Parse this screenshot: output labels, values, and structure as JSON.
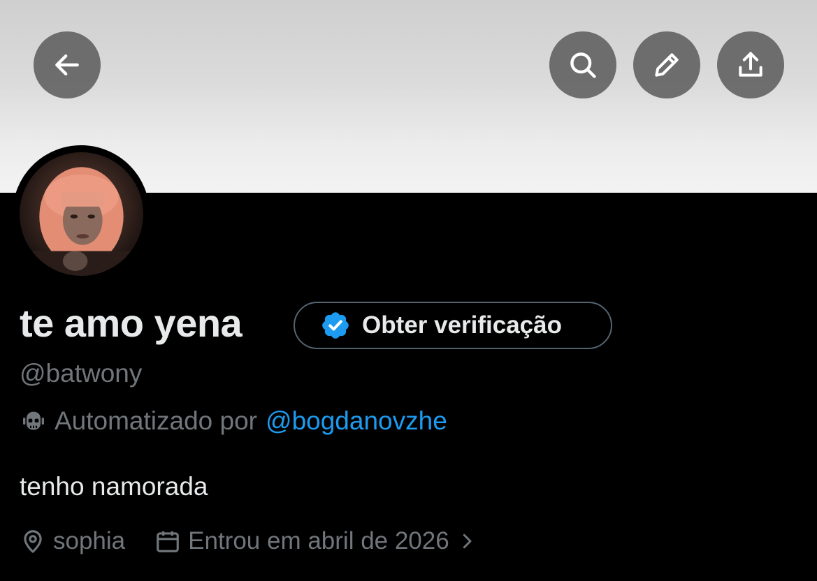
{
  "header": {
    "back_icon": "arrow-left-icon",
    "search_icon": "search-icon",
    "edit_icon": "pencil-icon",
    "share_icon": "share-upload-icon"
  },
  "profile": {
    "display_name": "te amo yena",
    "verify_button_label": "Obter verificação",
    "handle": "@batwony",
    "automated_label": "Automatizado por",
    "automated_by": "@bogdanovzhe",
    "bio": "tenho namorada",
    "location": "sophia",
    "joined": "Entrou em abril de 2026"
  },
  "colors": {
    "background": "#000000",
    "primary_text": "#e7e9ea",
    "secondary_text": "#71767b",
    "link": "#1d9bf0",
    "verified_badge": "#1d9bf0",
    "pill_border": "#536471"
  }
}
